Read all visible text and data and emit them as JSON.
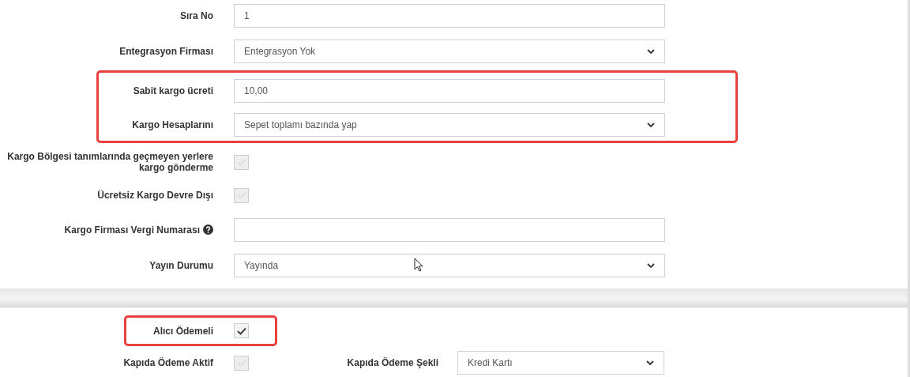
{
  "form": [
    {
      "kind": "input",
      "label": "Sıra No",
      "value": "1"
    },
    {
      "kind": "select",
      "label": "Entegrasyon Firması",
      "value": "Entegrasyon Yok"
    },
    {
      "kind": "highlight",
      "rows": [
        {
          "kind": "input",
          "label": "Sabit kargo ücreti",
          "value": "10,00"
        },
        {
          "kind": "select",
          "label": "Kargo Hesaplarını",
          "value": "Sepet toplamı bazında yap"
        }
      ]
    },
    {
      "kind": "checkbox",
      "label": "Kargo Bölgesi tanımlarında geçmeyen yerlere kargo gönderme",
      "checked": false
    },
    {
      "kind": "checkbox",
      "label": "Ücretsiz Kargo Devre Dışı",
      "checked": false
    },
    {
      "kind": "input",
      "label": "Kargo Firması Vergi Numarası",
      "help": true
    },
    {
      "kind": "select",
      "label": "Yayın Durumu",
      "value": "Yayında"
    }
  ],
  "payment": [
    {
      "kind": "highlight",
      "rows": [
        {
          "kind": "checkbox",
          "label": "Alıcı Ödemeli",
          "checked": true
        }
      ]
    },
    {
      "kind": "checkbox_select",
      "label": "Kapıda Ödeme Aktif",
      "checked": false,
      "select_label": "Kapıda Ödeme Şekli",
      "value": "Kredi Kartı"
    }
  ]
}
